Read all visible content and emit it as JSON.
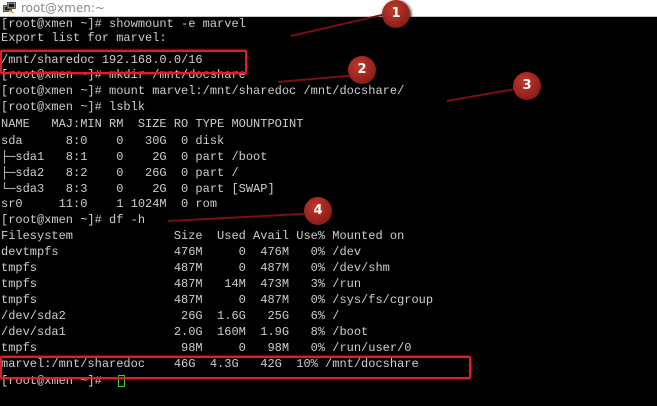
{
  "window": {
    "title": "root@xmen:~"
  },
  "terminal": {
    "lines": [
      "[root@xmen ~]# showmount -e marvel",
      "Export list for marvel:",
      "/mnt/sharedoc 192.168.0.0/16",
      "[root@xmen ~]# mkdir /mnt/docshare",
      "[root@xmen ~]# mount marvel:/mnt/sharedoc /mnt/docshare/",
      "[root@xmen ~]# lsblk",
      "NAME   MAJ:MIN RM  SIZE RO TYPE MOUNTPOINT",
      "sda      8:0    0   30G  0 disk",
      "├─sda1   8:1    0    2G  0 part /boot",
      "├─sda2   8:2    0   26G  0 part /",
      "└─sda3   8:3    0    2G  0 part [SWAP]",
      "sr0     11:0    1 1024M  0 rom",
      "[root@xmen ~]# df -h",
      "Filesystem              Size  Used Avail Use% Mounted on",
      "devtmpfs                476M     0  476M   0% /dev",
      "tmpfs                   487M     0  487M   0% /dev/shm",
      "tmpfs                   487M   14M  473M   3% /run",
      "tmpfs                   487M     0  487M   0% /sys/fs/cgroup",
      "/dev/sda2                26G  1.6G   25G   6% /",
      "/dev/sda1               2.0G  160M  1.9G   8% /boot",
      "tmpfs                    98M     0   98M   0% /run/user/0",
      "marvel:/mnt/sharedoc    46G  4.3G   42G  10% /mnt/docshare",
      "[root@xmen ~]# "
    ],
    "cursor_color": "#39d039",
    "text_color": "#cdcdcd"
  },
  "annotations": {
    "badges": [
      "1",
      "2",
      "3",
      "4"
    ],
    "color": "#c0392b"
  }
}
